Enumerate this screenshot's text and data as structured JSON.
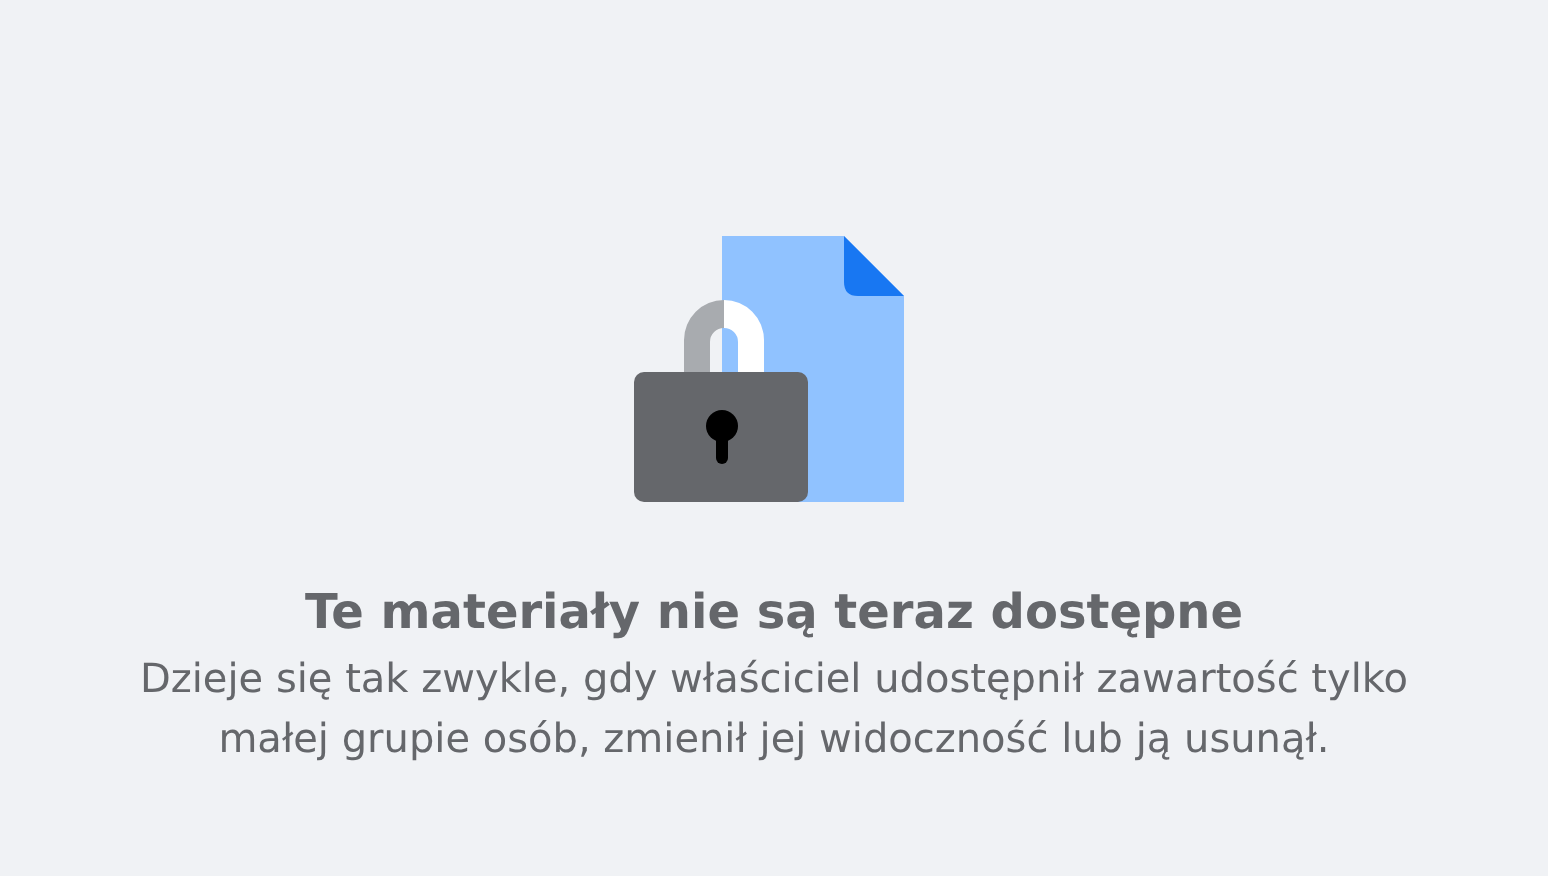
{
  "title": "Te materiały nie są teraz dostępne",
  "message": "Dzieje się tak zwykle, gdy właściciel udostępnił zawartość tylko małej grupie osób, zmienił jej widoczność lub ją usunął."
}
